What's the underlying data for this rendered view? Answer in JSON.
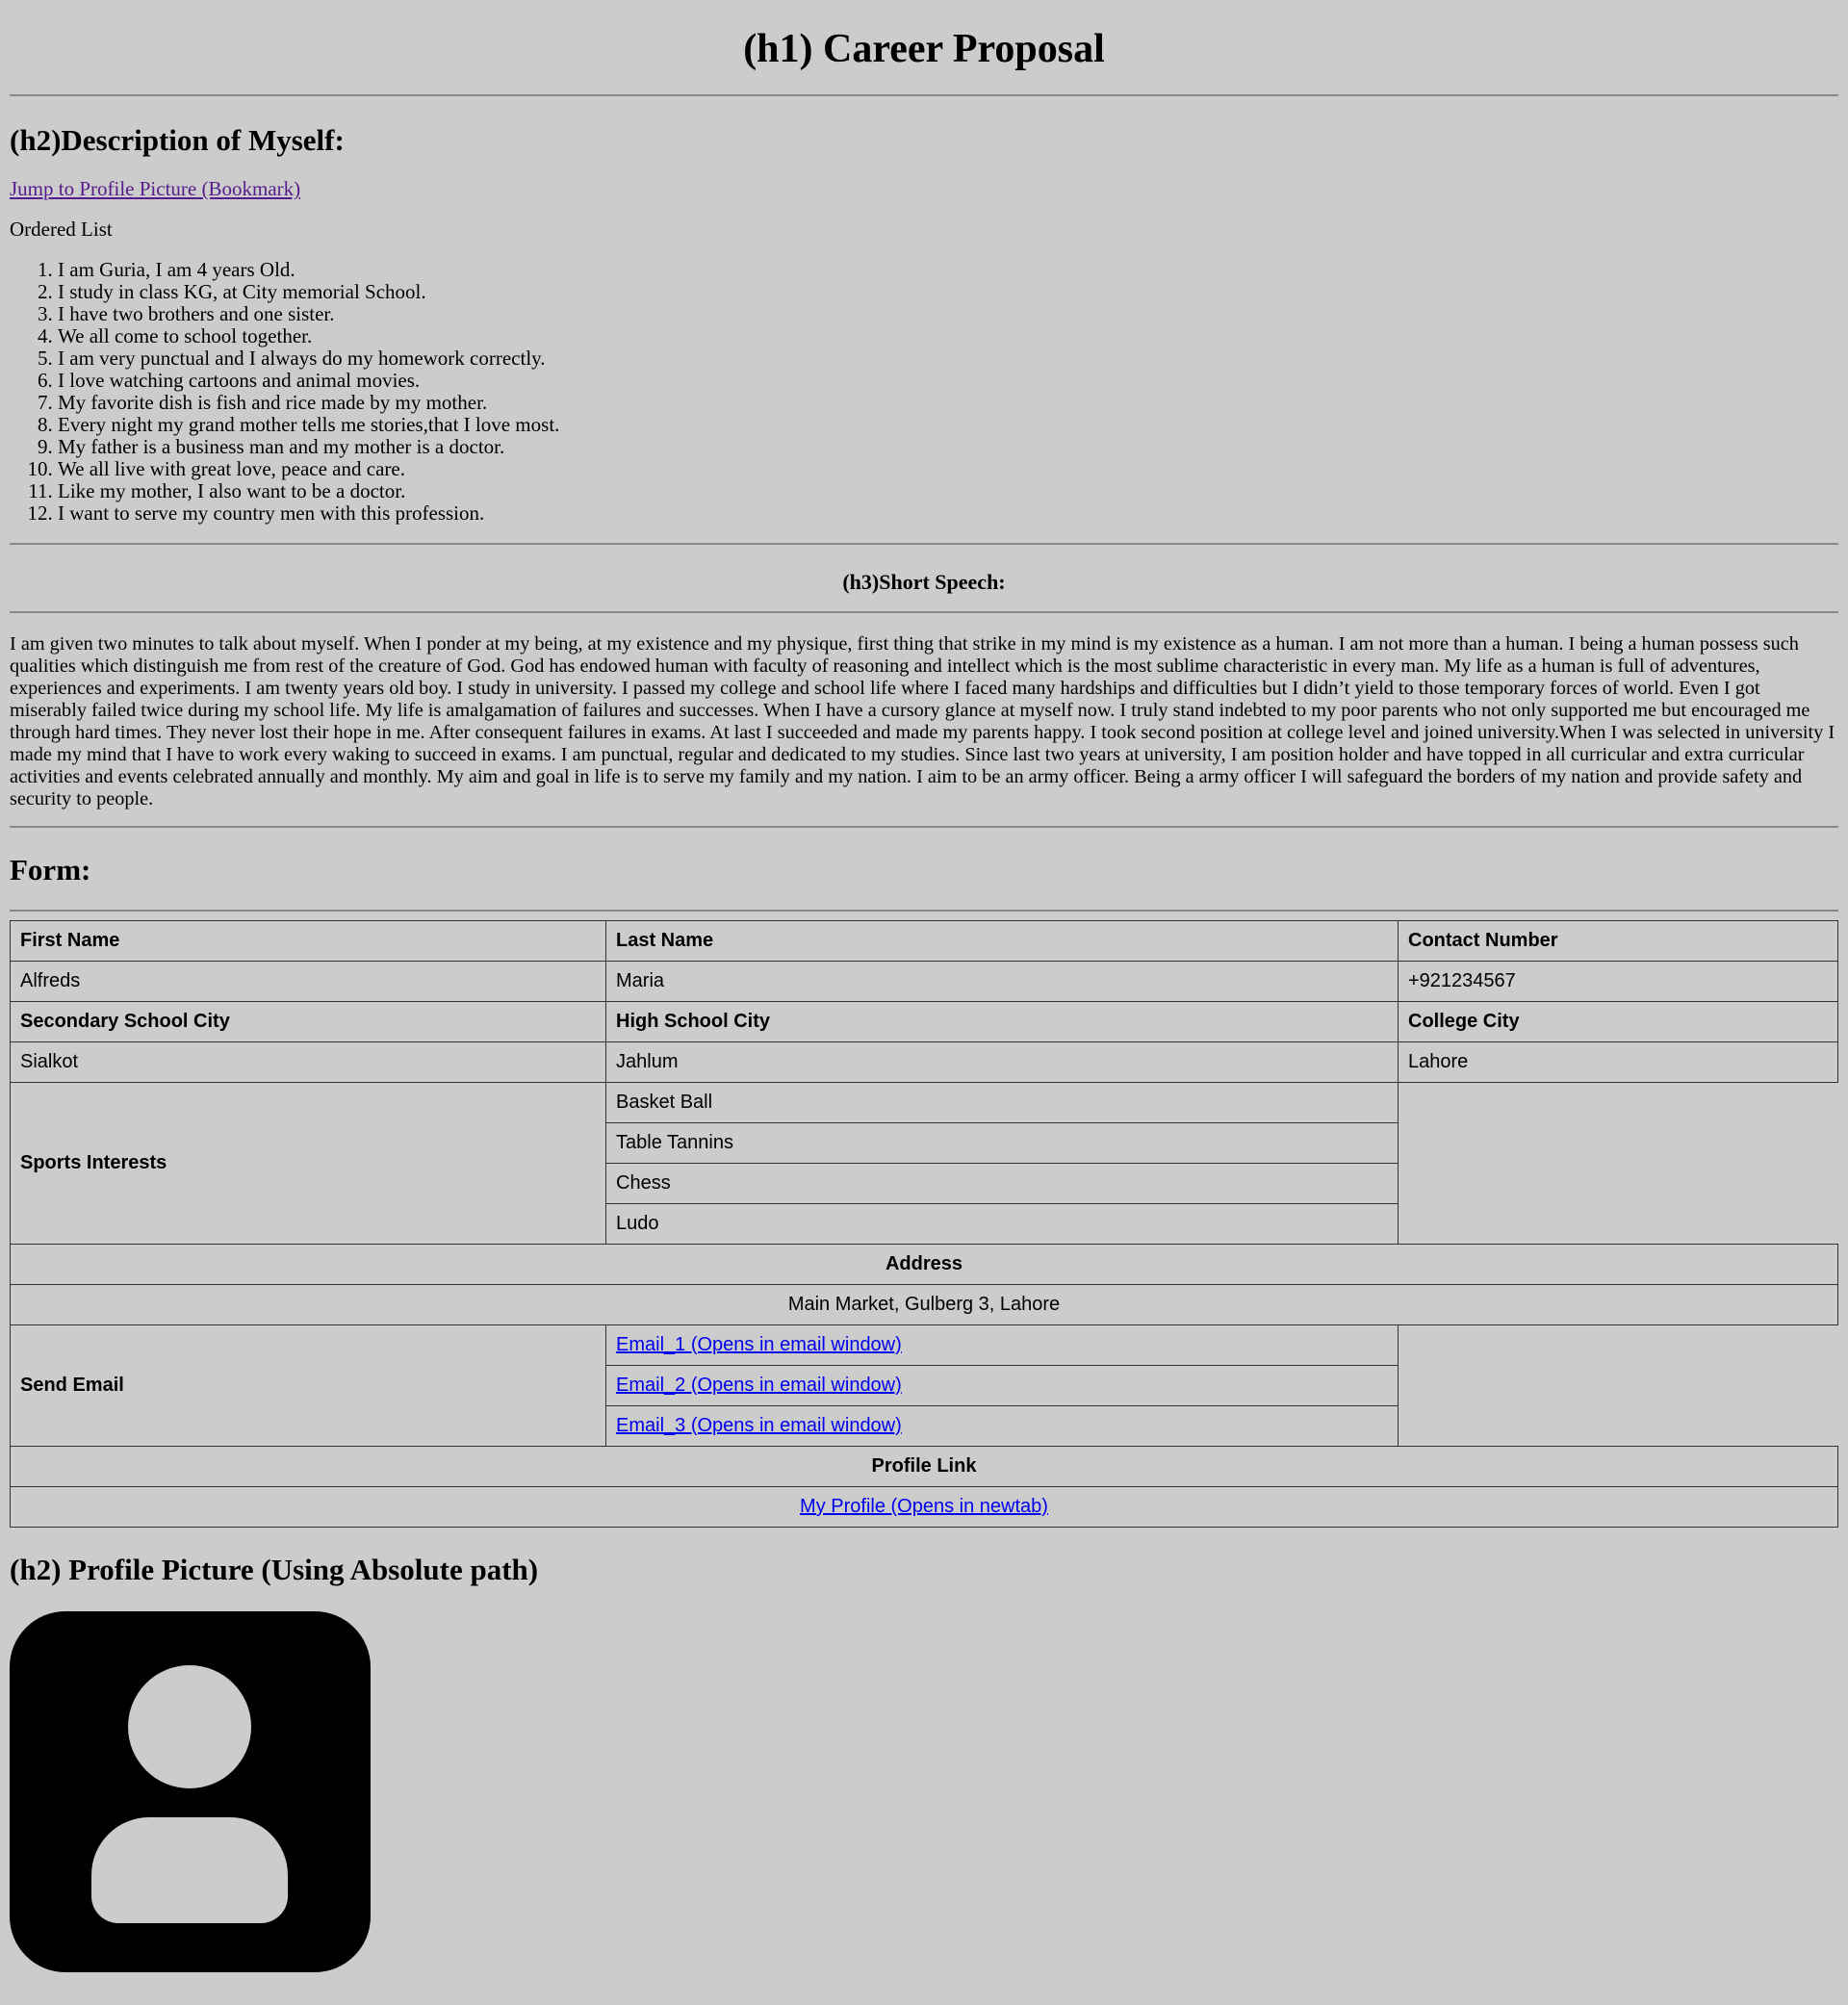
{
  "title": "(h1) Career Proposal",
  "description": {
    "heading": "(h2)Description of Myself:",
    "bookmark_link": "Jump to Profile Picture (Bookmark)",
    "list_title": "Ordered List",
    "items": [
      "I am Guria, I am 4 years Old.",
      "I study in class KG, at City memorial School.",
      "I have two brothers and one sister.",
      "We all come to school together.",
      "I am very punctual and I always do my homework correctly.",
      "I love watching cartoons and animal movies.",
      "My favorite dish is fish and rice made by my mother.",
      "Every night my grand mother tells me stories,that I love most.",
      "My father is a business man and my mother is a doctor.",
      "We all live with great love, peace and care.",
      "Like my mother, I also want to be a doctor.",
      "I want to serve my country men with this profession."
    ]
  },
  "speech": {
    "heading": "(h3)Short Speech:",
    "text": "I am given two minutes to talk about myself. When I ponder at my being, at my existence and my physique, first thing that strike in my mind is my existence as a human. I am not more than a human. I being a human possess such qualities which distinguish me from rest of the creature of God. God has endowed human with faculty of reasoning and intellect which is the most sublime characteristic in every man. My life as a human is full of adventures, experiences and experiments. I am twenty years old boy. I study in university. I passed my college and school life where I faced many hardships and difficulties but I didn’t yield to those temporary forces of world. Even I got miserably failed twice during my school life. My life is amalgamation of failures and successes. When I have a cursory glance at myself now. I truly stand indebted to my poor parents who not only supported me but encouraged me through hard times. They never lost their hope in me. After consequent failures in exams. At last I succeeded and made my parents happy. I took second position at college level and joined university.When I was selected in university I made my mind that I have to work every waking to succeed in exams. I am punctual, regular and dedicated to my studies. Since last two years at university, I am position holder and have topped in all curricular and extra curricular activities and events celebrated annually and monthly. My aim and goal in life is to serve my family and my nation. I aim to be an army officer. Being a army officer I will safeguard the borders of my nation and provide safety and security to people."
  },
  "form": {
    "heading": "Form:",
    "first_name_label": "First Name",
    "last_name_label": "Last Name",
    "contact_label": "Contact Number",
    "first_name": "Alfreds",
    "last_name": "Maria",
    "contact": "+921234567",
    "secondary_city_label": "Secondary School City",
    "high_city_label": "High School City",
    "college_city_label": "College City",
    "secondary_city": "Sialkot",
    "high_city": "Jahlum",
    "college_city": "Lahore",
    "sports_label": "Sports Interests",
    "sports": [
      "Basket Ball",
      "Table Tannins",
      "Chess",
      "Ludo"
    ],
    "address_label": "Address",
    "address": "Main Market, Gulberg 3, Lahore",
    "email_label": "Send Email",
    "emails": [
      "Email_1 (Opens in email window)",
      "Email_2 (Opens in email window)",
      "Email_3 (Opens in email window)"
    ],
    "profile_link_label": "Profile Link",
    "profile_link": "My Profile (Opens in newtab)"
  },
  "profile_picture": {
    "heading": "(h2) Profile Picture (Using Absolute path)",
    "icon": "user-avatar-icon"
  }
}
